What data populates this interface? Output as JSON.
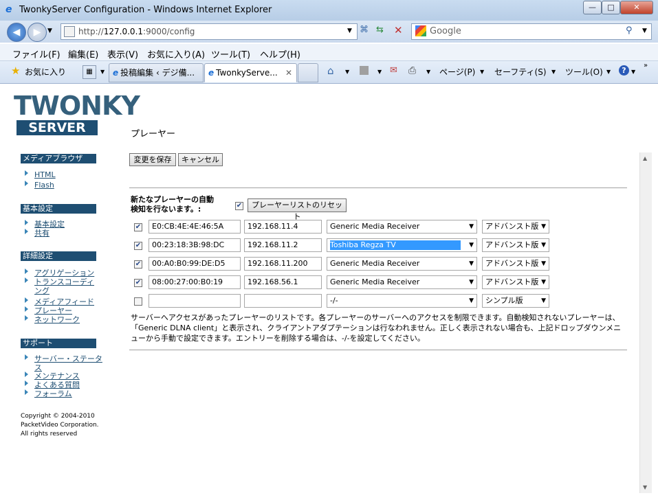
{
  "window": {
    "title": "TwonkyServer Configuration - Windows Internet Explorer",
    "minimize": "—",
    "maximize": "□",
    "close": "✕"
  },
  "address": {
    "url_prefix": "http://",
    "url_host": "127.0.0.1",
    "url_path": ":9000/config",
    "search_placeholder": "Google"
  },
  "menu": [
    "ファイル(F)",
    "編集(E)",
    "表示(V)",
    "お気に入り(A)",
    "ツール(T)",
    "ヘルプ(H)"
  ],
  "favbar": {
    "favorites": "お気に入り",
    "tabs": [
      "投稿編集 ‹ デジ備...",
      "TwonkyServe..."
    ],
    "commands": [
      "ページ(P)",
      "セーフティ(S)",
      "ツール(O)"
    ]
  },
  "logo": {
    "top": "TWONKY",
    "bottom": "SERVER"
  },
  "sidebar": {
    "sections": [
      {
        "title": "メディアブラウザ",
        "links": [
          "HTML",
          "Flash"
        ]
      },
      {
        "title": "基本設定",
        "links": [
          "基本設定",
          "共有"
        ]
      },
      {
        "title": "詳細設定",
        "links": [
          "アグリゲーション",
          "トランスコーディング",
          "メディアフィード",
          "プレーヤー",
          "ネットワーク"
        ]
      },
      {
        "title": "サポート",
        "links": [
          "サーバー・ステータス",
          "メンテナンス",
          "よくある質問",
          "フォーラム"
        ]
      }
    ],
    "copyright": [
      "Copyright © 2004-2010",
      "PacketVideo Corporation.",
      "All rights reserved"
    ]
  },
  "main": {
    "title": "プレーヤー",
    "save_button": "変更を保存",
    "cancel_button": "キャンセル",
    "auto_detect_label_1": "新たなプレーヤーの自動",
    "auto_detect_label_2": "検知を行ないます。:",
    "reset_button": "プレーヤーリストのリセット",
    "players": [
      {
        "checked": true,
        "mac": "E0:CB:4E:4E:46:5A",
        "ip": "192.168.11.4",
        "receiver": "Generic Media Receiver",
        "mode": "アドバンスト版"
      },
      {
        "checked": true,
        "mac": "00:23:18:3B:98:DC",
        "ip": "192.168.11.2",
        "receiver": "Toshiba Regza TV",
        "mode": "アドバンスト版"
      },
      {
        "checked": true,
        "mac": "00:A0:B0:99:DE:D5",
        "ip": "192.168.11.200",
        "receiver": "Generic Media Receiver",
        "mode": "アドバンスト版"
      },
      {
        "checked": true,
        "mac": "08:00:27:00:B0:19",
        "ip": "192.168.56.1",
        "receiver": "Generic Media Receiver",
        "mode": "アドバンスト版"
      },
      {
        "checked": false,
        "mac": "",
        "ip": "",
        "receiver": "-/-",
        "mode": "シンプル版"
      }
    ],
    "description": "サーバーへアクセスがあったプレーヤーのリストです。各プレーヤーのサーバーへのアクセスを制限できます。自動検知されないプレーヤーは、「Generic DLNA client」と表示され、クライアントアダプテーションは行なわれません。正しく表示されない場合も、上記ドロップダウンメニューから手動で設定できます。エントリーを削除する場合は、-/-を設定してください。"
  },
  "colors": {
    "accent": "#1e4e72",
    "logo_text": "#35607c",
    "link": "#1e4e72",
    "selected": "#3399ff"
  }
}
